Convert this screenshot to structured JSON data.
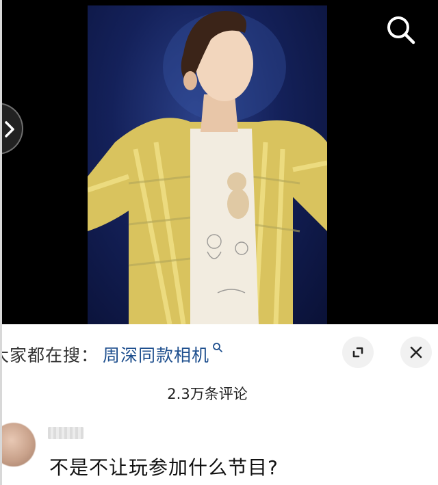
{
  "video": {
    "search_icon": "search-icon",
    "prev_icon": "chevron-right-icon"
  },
  "search_bar": {
    "prefix": "大家都在搜：",
    "term": "周深同款相机",
    "term_icon": "search-icon",
    "term_color": "#1e4f8e"
  },
  "controls": {
    "expand_icon": "expand-icon",
    "close_icon": "close-icon"
  },
  "comments": {
    "count_label": "2.3万条评论",
    "items": [
      {
        "text": "不是不让玩参加什么节目?"
      }
    ]
  }
}
